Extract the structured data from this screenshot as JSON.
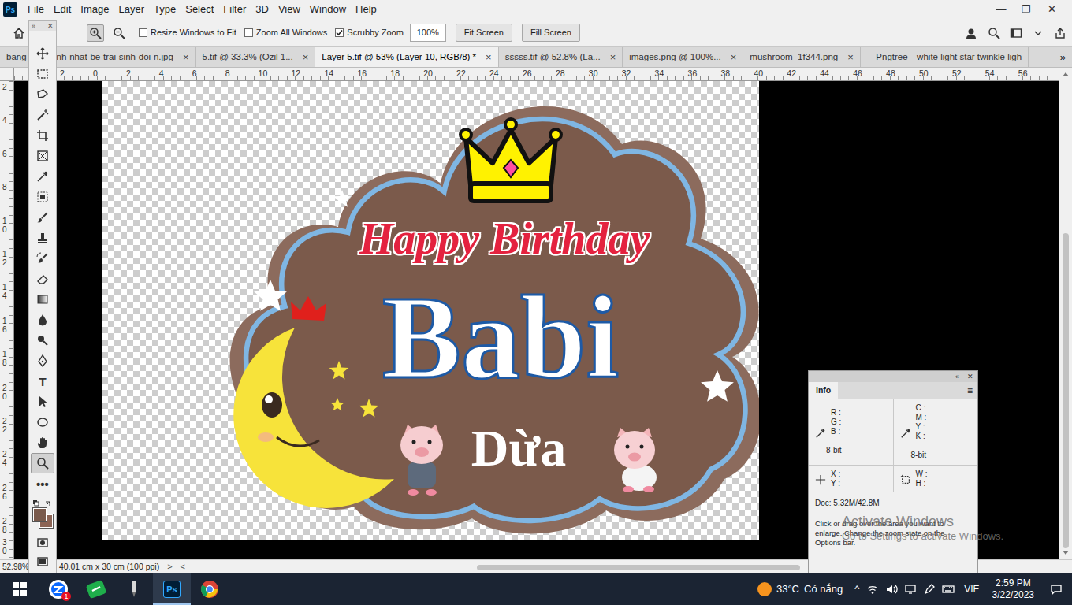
{
  "app": {
    "logo": "Ps"
  },
  "menu": [
    "File",
    "Edit",
    "Image",
    "Layer",
    "Type",
    "Select",
    "Filter",
    "3D",
    "View",
    "Window",
    "Help"
  ],
  "window_controls": [
    "—",
    "❐",
    "✕"
  ],
  "options_bar": {
    "zoom_mode": [
      {
        "selected": true
      },
      {
        "selected": false
      }
    ],
    "checkboxes": [
      {
        "label": "Resize Windows to Fit",
        "checked": false
      },
      {
        "label": "Zoom All Windows",
        "checked": false
      },
      {
        "label": "Scrubby Zoom",
        "checked": true
      }
    ],
    "zoom_value": "100%",
    "buttons": [
      "Fit Screen",
      "Fill Screen"
    ]
  },
  "tabs": [
    {
      "label": "bang",
      "label_end": "nh-nhat-be-trai-sinh-doi-n.jpg",
      "selected": false,
      "close": "×"
    },
    {
      "label": "5.tif @ 33.3% (Ozil 1...",
      "selected": false,
      "close": "×"
    },
    {
      "label": "Layer 5.tif @ 53% (Layer 10, RGB/8) *",
      "selected": true,
      "close": "×"
    },
    {
      "label": "sssss.tif @ 52.8% (La...",
      "selected": false,
      "close": "×"
    },
    {
      "label": "images.png @ 100%...",
      "selected": false,
      "close": "×"
    },
    {
      "label": "mushroom_1f344.png",
      "selected": false,
      "close": "×"
    },
    {
      "label": "—Pngtree—white light star twinkle ligh",
      "selected": false,
      "close": ""
    }
  ],
  "tabs_more": "»",
  "rulers": {
    "top": [
      "2",
      "0",
      "2",
      "4",
      "6",
      "8",
      "10",
      "12",
      "14",
      "16",
      "18",
      "20",
      "22",
      "24",
      "26",
      "28",
      "30",
      "32",
      "34",
      "36",
      "38",
      "40",
      "42",
      "44",
      "46",
      "48",
      "50",
      "52",
      "54",
      "56"
    ],
    "left": [
      "2",
      "4",
      "6",
      "8",
      "10",
      "12",
      "14",
      "16",
      "18",
      "20",
      "22",
      "24",
      "26",
      "28",
      "30"
    ]
  },
  "toolbar": {
    "header": [
      "»",
      "✕"
    ],
    "tools": [
      {
        "selected": false
      },
      {
        "selected": false
      },
      {
        "selected": false
      },
      {
        "selected": false
      },
      {
        "selected": false
      },
      {
        "selected": false
      },
      {
        "selected": false
      },
      {
        "selected": false
      },
      {
        "selected": false
      },
      {
        "selected": false
      },
      {
        "selected": false
      },
      {
        "selected": false
      },
      {
        "selected": false
      },
      {
        "selected": false
      },
      {
        "selected": false
      },
      {
        "selected": false
      },
      {
        "label": "T",
        "selected": false
      },
      {
        "selected": false
      },
      {
        "selected": false
      },
      {
        "selected": false
      },
      {
        "selected": true
      },
      {
        "label": "•••",
        "selected": false
      }
    ]
  },
  "artwork": {
    "title": "Happy Birthday",
    "name": "Babi",
    "subtitle": "Dừa"
  },
  "status_bar": {
    "zoom": "52.98%",
    "doc_size": "40.01 cm x 30 cm (100 ppi)",
    "arrow_right": ">",
    "arrow_left": "<"
  },
  "info_panel": {
    "collapse": "«",
    "close": "✕",
    "tab": "Info",
    "menu": "≡",
    "rgb": [
      "R :",
      "G :",
      "B :"
    ],
    "rgb_depth": "8-bit",
    "cmyk": [
      "C :",
      "M :",
      "Y :",
      "K :"
    ],
    "cmyk_depth": "8-bit",
    "xy": [
      "X :",
      "Y :"
    ],
    "wh": [
      "W :",
      "H :"
    ],
    "doc": "Doc: 5.32M/42.8M",
    "help": "Click or drag over the area you want to enlarge. Change the zoom state on the Options bar."
  },
  "watermark": {
    "title": "Activate Windows",
    "subtitle": "Go to Settings to activate Windows."
  },
  "taskbar": {
    "apps": [
      {
        "badge": "1",
        "active": false
      },
      {
        "active": false
      },
      {
        "active": false
      },
      {
        "label": "Ps",
        "active": true
      },
      {
        "active": false
      }
    ],
    "weather": {
      "temp": "33°C",
      "condition": "Có nắng"
    },
    "tray_expand": "^",
    "language": "VIE",
    "time": "2:59 PM",
    "date": "3/22/2023"
  }
}
